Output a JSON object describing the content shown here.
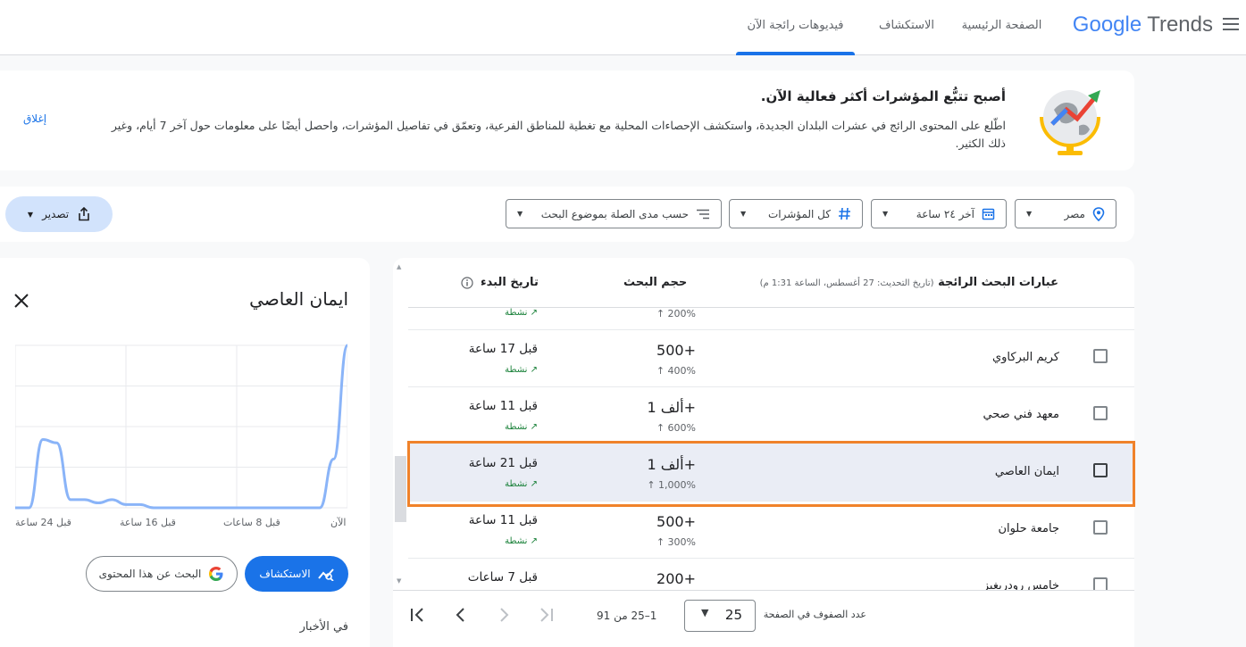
{
  "header": {
    "logo_google": "Google",
    "logo_trends": "Trends",
    "tabs": [
      {
        "label": "الصفحة الرئيسية"
      },
      {
        "label": "الاستكشاف"
      },
      {
        "label": "فيديوهات رائجة الآن"
      }
    ]
  },
  "banner": {
    "title": "أصبح تتبُّع المؤشرات أكثر فعالية الآن.",
    "text": "اطّلع على المحتوى الرائج في عشرات البلدان الجديدة، واستكشف الإحصاءات المحلية مع تغطية للمناطق الفرعية، وتعمّق في تفاصيل المؤشرات، واحصل أيضًا على معلومات حول آخر 7 أيام، وغير ذلك الكثير.",
    "dismiss": "إغلاق"
  },
  "filters": {
    "location": "مصر",
    "time": "آخر ٢٤ ساعة",
    "category": "كل المؤشرات",
    "sort": "حسب مدى الصلة بموضوع البحث",
    "export": "تصدير"
  },
  "table": {
    "col_trends": "عبارات البحث الرائجة",
    "updated": "(تاريخ التحديث: 27 أغسطس، الساعة 1:31 م)",
    "col_volume": "حجم البحث",
    "col_started": "تاريخ البدء",
    "rows": [
      {
        "name": "",
        "volume": "",
        "pct": "↑ 200%",
        "started": "",
        "status": "نشطة"
      },
      {
        "name": "كريم البركاوي",
        "volume": "+500",
        "pct": "↑ 400%",
        "started": "قبل 17 ساعة",
        "status": "نشطة"
      },
      {
        "name": "معهد فني صحي",
        "volume": "+ألف 1",
        "pct": "↑ 600%",
        "started": "قبل 11 ساعة",
        "status": "نشطة"
      },
      {
        "name": "ايمان العاصي",
        "volume": "+ألف 1",
        "pct": "↑ 1,000%",
        "started": "قبل 21 ساعة",
        "status": "نشطة"
      },
      {
        "name": "جامعة حلوان",
        "volume": "+500",
        "pct": "↑ 300%",
        "started": "قبل 11 ساعة",
        "status": "نشطة"
      },
      {
        "name": "خامس رودريغيز",
        "volume": "+200",
        "pct": "",
        "started": "قبل 7 ساعات",
        "status": ""
      }
    ],
    "pager": {
      "rows_label": "عدد الصفوف في الصفحة",
      "rows_value": "25",
      "range": "1–25 من 91"
    }
  },
  "side": {
    "title": "ايمان العاصي",
    "x_labels": [
      "قبل 24 ساعة",
      "قبل 16 ساعة",
      "قبل 8 ساعات",
      "الآن"
    ],
    "explore": "الاستكشاف",
    "search": "البحث عن هذا المحتوى",
    "news": "في الأخبار"
  },
  "chart_data": {
    "type": "line",
    "x": [
      "قبل 24 ساعة",
      "",
      "",
      "",
      "",
      "",
      "",
      "",
      "قبل 16 ساعة",
      "",
      "",
      "",
      "",
      "",
      "",
      "",
      "قبل 8 ساعات",
      "",
      "",
      "",
      "",
      "",
      "",
      "",
      "الآن"
    ],
    "series": [
      {
        "values": [
          0,
          0,
          42,
          40,
          5,
          5,
          3,
          5,
          2,
          2,
          0,
          0,
          0,
          0,
          0,
          0,
          0,
          0,
          0,
          0,
          0,
          0,
          0,
          30,
          100
        ]
      }
    ],
    "xlabel": "",
    "ylabel": "",
    "ylim": [
      0,
      100
    ]
  },
  "colors": {
    "accent": "#1a73e8",
    "highlight": "#f0822a",
    "line": "#8ab4f8"
  }
}
